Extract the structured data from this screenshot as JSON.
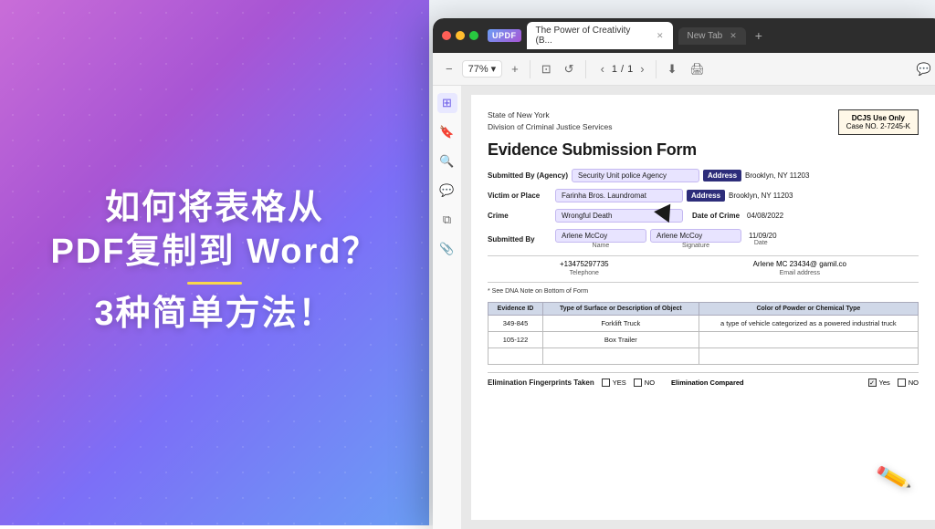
{
  "left": {
    "line1": "如何将表格从",
    "line2": "PDF复制到 Word？",
    "line3": "3种简单方法！"
  },
  "browser": {
    "updf_label": "UPDF",
    "tab_active_label": "The Power of Creativity (B...",
    "tab_new_label": "New Tab",
    "zoom": "77%",
    "zoom_minus": "−",
    "zoom_plus": "+",
    "page_current": "1",
    "page_total": "1"
  },
  "pdf": {
    "org_line1": "State of New York",
    "org_line2": "Division of Criminal Justice Services",
    "dcjs_title": "DCJS Use Only",
    "case_no": "Case NO. 2-7245-K",
    "form_title": "Evidence Submission Form",
    "submitted_by_label": "Submitted By (Agency)",
    "submitted_by_value": "Security Unit police Agency",
    "address_label": "Address",
    "address_value1": "Brooklyn, NY 11203",
    "victim_label": "Victim or Place",
    "victim_value": "Farinha Bros. Laundromat",
    "address_label2": "Address",
    "address_value2": "Brooklyn, NY 11203",
    "crime_label": "Crime",
    "crime_value": "Wrongful Death",
    "date_crime_label": "Date of Crime",
    "date_crime_value": "04/08/2022",
    "submitted_by_label2": "Submitted By",
    "name_value": "Arlene McCoy",
    "signature_value": "Arlene McCoy",
    "date_submitted": "11/09/20",
    "name_caption": "Name",
    "signature_caption": "Signature",
    "date_caption": "Date",
    "telephone": "+13475297735",
    "email": "Arlene MC 23434@ gamil.co",
    "telephone_caption": "Telephone",
    "email_caption": "Email address",
    "dna_note": "* See DNA Note on Bottom of Form",
    "table": {
      "headers": [
        "Evidence ID",
        "Type of Surface or Description of Object",
        "Color of Powder or Chemical Type"
      ],
      "rows": [
        {
          "id": "349-845",
          "desc": "Forklift Truck",
          "color": "a type of vehicle categorized as a powered industrial truck"
        },
        {
          "id": "105-122",
          "desc": "Box Trailer",
          "color": ""
        }
      ]
    },
    "fingerprints_label": "Elimination Fingerprints Taken",
    "yes_label": "YES",
    "no_label": "NO",
    "elim_compared_label": "Elimination Compared",
    "yes_label2": "Yes",
    "no_label2": "NO"
  }
}
